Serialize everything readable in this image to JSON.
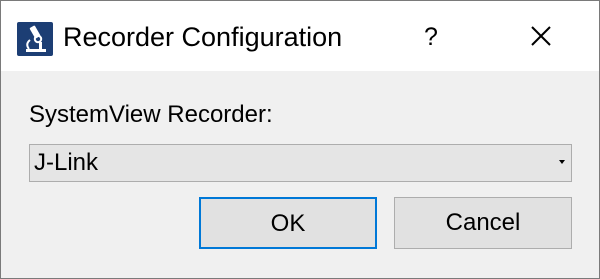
{
  "window": {
    "title": "Recorder Configuration",
    "help_label": "?",
    "app_icon": "microscope-icon",
    "close_icon": "close-icon"
  },
  "form": {
    "recorder_label": "SystemView Recorder:",
    "recorder_value": "J-Link"
  },
  "buttons": {
    "ok_label": "OK",
    "cancel_label": "Cancel"
  },
  "colors": {
    "focus_border": "#0078d7",
    "titlebar_bg": "#ffffff",
    "dialog_bg": "#f0f0f0",
    "icon_bg": "#1c3e74"
  }
}
